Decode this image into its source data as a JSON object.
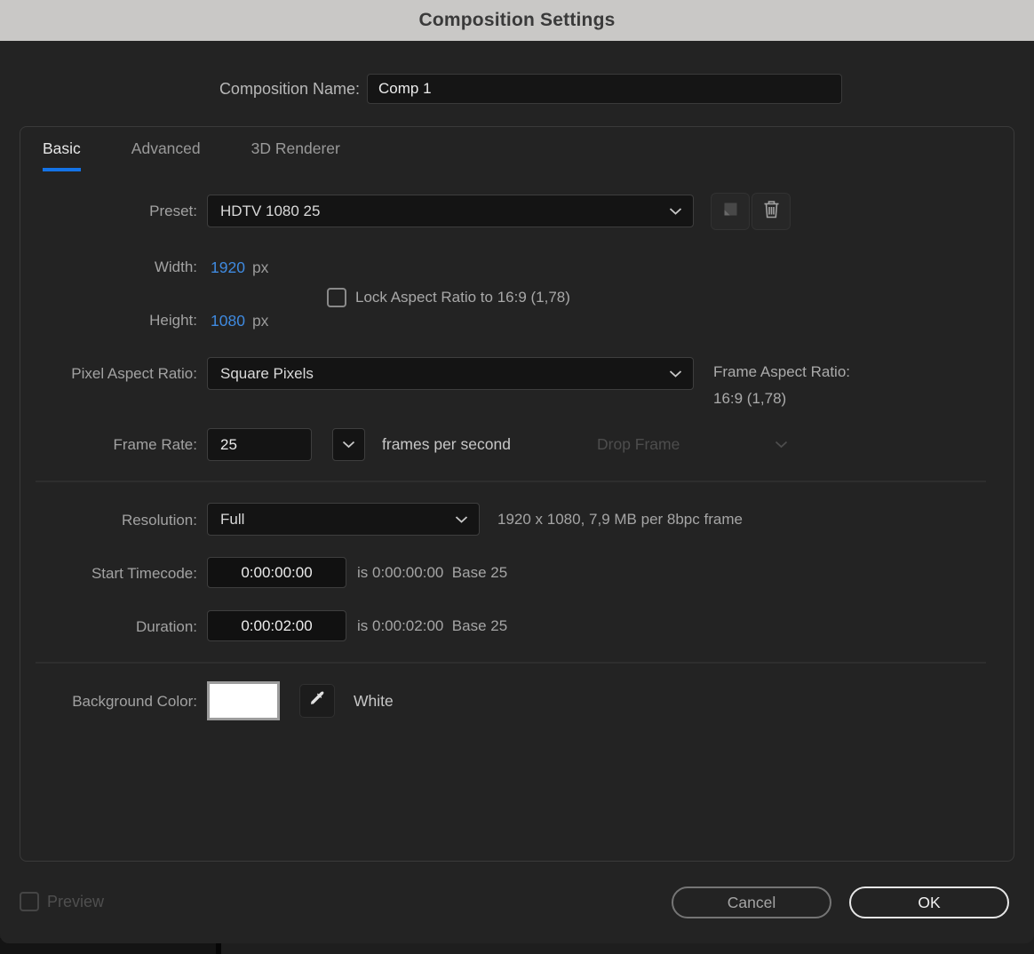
{
  "title": "Composition Settings",
  "composition_name": {
    "label": "Composition Name:",
    "value": "Comp 1"
  },
  "tabs": [
    {
      "label": "Basic"
    },
    {
      "label": "Advanced"
    },
    {
      "label": "3D Renderer"
    }
  ],
  "preset": {
    "label": "Preset:",
    "value": "HDTV 1080 25"
  },
  "dimensions": {
    "width_label": "Width:",
    "width_value": "1920",
    "width_unit": "px",
    "height_label": "Height:",
    "height_value": "1080",
    "height_unit": "px",
    "lock_label": "Lock Aspect Ratio to 16:9 (1,78)",
    "lock_checked": false
  },
  "pixel_aspect_ratio": {
    "label": "Pixel Aspect Ratio:",
    "value": "Square Pixels",
    "frame_aspect_label": "Frame Aspect Ratio:",
    "frame_aspect_value": "16:9 (1,78)"
  },
  "frame_rate": {
    "label": "Frame Rate:",
    "value": "25",
    "unit": "frames per second",
    "drop_frame_label": "Drop Frame",
    "drop_frame_enabled": false
  },
  "resolution": {
    "label": "Resolution:",
    "value": "Full",
    "info": "1920 x 1080, 7,9 MB per 8bpc frame"
  },
  "start_timecode": {
    "label": "Start Timecode:",
    "value": "0:00:00:00",
    "info": "is 0:00:00:00  Base 25"
  },
  "duration": {
    "label": "Duration:",
    "value": "0:00:02:00",
    "info": "is 0:00:02:00  Base 25"
  },
  "background_color": {
    "label": "Background Color:",
    "swatch_color": "#ffffff",
    "color_name": "White"
  },
  "footer": {
    "preview_label": "Preview",
    "preview_checked": false,
    "cancel_label": "Cancel",
    "ok_label": "OK"
  },
  "colors": {
    "accent_blue": "#3f8ae0",
    "tab_underline_blue": "#1473e6",
    "titlebar_bg": "#c9c8c6",
    "dialog_bg": "#232323"
  }
}
